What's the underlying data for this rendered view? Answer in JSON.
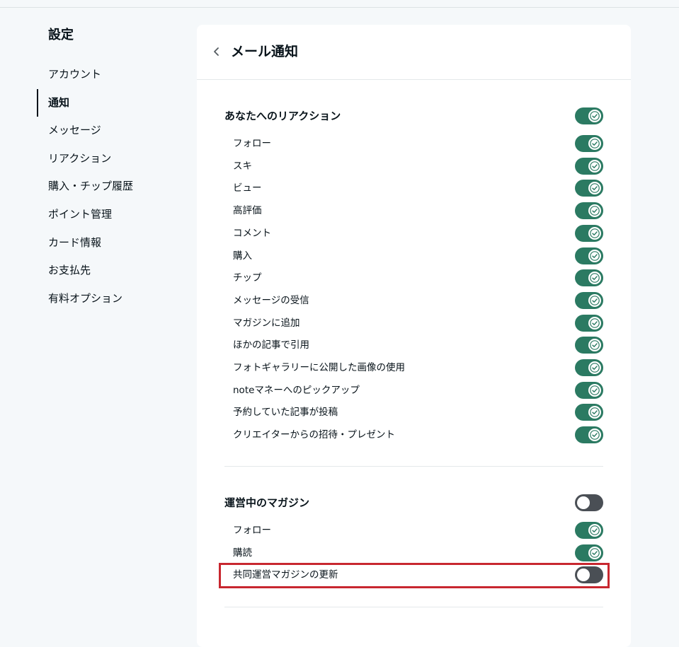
{
  "sidebar": {
    "title": "設定",
    "items": [
      {
        "label": "アカウント",
        "active": false
      },
      {
        "label": "通知",
        "active": true
      },
      {
        "label": "メッセージ",
        "active": false
      },
      {
        "label": "リアクション",
        "active": false
      },
      {
        "label": "購入・チップ履歴",
        "active": false
      },
      {
        "label": "ポイント管理",
        "active": false
      },
      {
        "label": "カード情報",
        "active": false
      },
      {
        "label": "お支払先",
        "active": false
      },
      {
        "label": "有料オプション",
        "active": false
      }
    ]
  },
  "main": {
    "title": "メール通知",
    "back_icon": "chevron-left-icon",
    "sections": [
      {
        "heading": "あなたへのリアクション",
        "heading_on": true,
        "items": [
          {
            "label": "フォロー",
            "on": true
          },
          {
            "label": "スキ",
            "on": true
          },
          {
            "label": "ビュー",
            "on": true
          },
          {
            "label": "高評価",
            "on": true
          },
          {
            "label": "コメント",
            "on": true
          },
          {
            "label": "購入",
            "on": true
          },
          {
            "label": "チップ",
            "on": true
          },
          {
            "label": "メッセージの受信",
            "on": true
          },
          {
            "label": "マガジンに追加",
            "on": true
          },
          {
            "label": "ほかの記事で引用",
            "on": true
          },
          {
            "label": "フォトギャラリーに公開した画像の使用",
            "on": true
          },
          {
            "label": "noteマネーへのピックアップ",
            "on": true
          },
          {
            "label": "予約していた記事が投稿",
            "on": true
          },
          {
            "label": "クリエイターからの招待・プレゼント",
            "on": true
          }
        ]
      },
      {
        "heading": "運営中のマガジン",
        "heading_on": false,
        "items": [
          {
            "label": "フォロー",
            "on": true
          },
          {
            "label": "購読",
            "on": true
          },
          {
            "label": "共同運営マガジンの更新",
            "on": false
          }
        ]
      }
    ]
  },
  "colors": {
    "toggle_on": "#2b7a62",
    "toggle_off": "#4a4f55",
    "highlight": "#c8272f",
    "page_background": "#f5f8fa"
  }
}
